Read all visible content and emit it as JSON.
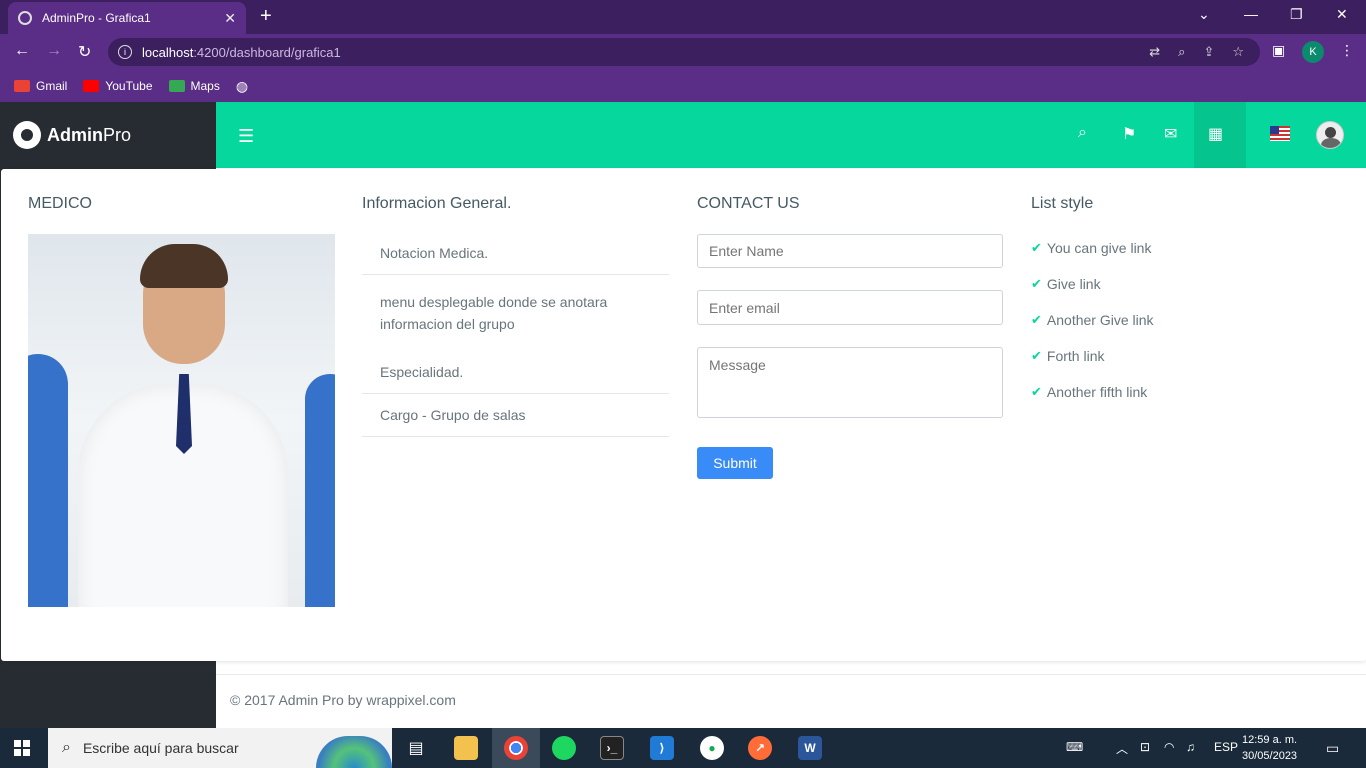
{
  "browser": {
    "tab_title": "AdminPro - Grafica1",
    "tab_close": "✕",
    "new_tab": "+",
    "url_host": "localhost",
    "url_path": ":4200/dashboard/grafica1",
    "profile_initial": "K",
    "bookmarks": [
      {
        "label": "Gmail",
        "color": "#ea4335"
      },
      {
        "label": "YouTube",
        "color": "#ff0000"
      },
      {
        "label": "Maps",
        "color": "#34a853"
      }
    ]
  },
  "app": {
    "logo_bold": "Admin",
    "logo_light": "Pro",
    "accent_color": "#06d79c"
  },
  "medico": {
    "title": "MEDICO"
  },
  "info_general": {
    "title": "Informacion General.",
    "items": [
      "Notacion Medica.",
      "menu desplegable donde se anotara informacion del grupo",
      "Especialidad.",
      "Cargo - Grupo de salas"
    ]
  },
  "contact": {
    "title": "CONTACT US",
    "name_placeholder": "Enter Name",
    "email_placeholder": "Enter email",
    "message_placeholder": "Message",
    "submit_label": "Submit"
  },
  "list_style": {
    "title": "List style",
    "items": [
      "You can give link",
      "Give link",
      "Another Give link",
      "Forth link",
      "Another fifth link"
    ]
  },
  "footer": {
    "text": "© 2017 Admin Pro by wrappixel.com"
  },
  "taskbar": {
    "search_placeholder": "Escribe aquí para buscar",
    "language": "ESP",
    "time": "12:59 a. m.",
    "date": "30/05/2023"
  }
}
